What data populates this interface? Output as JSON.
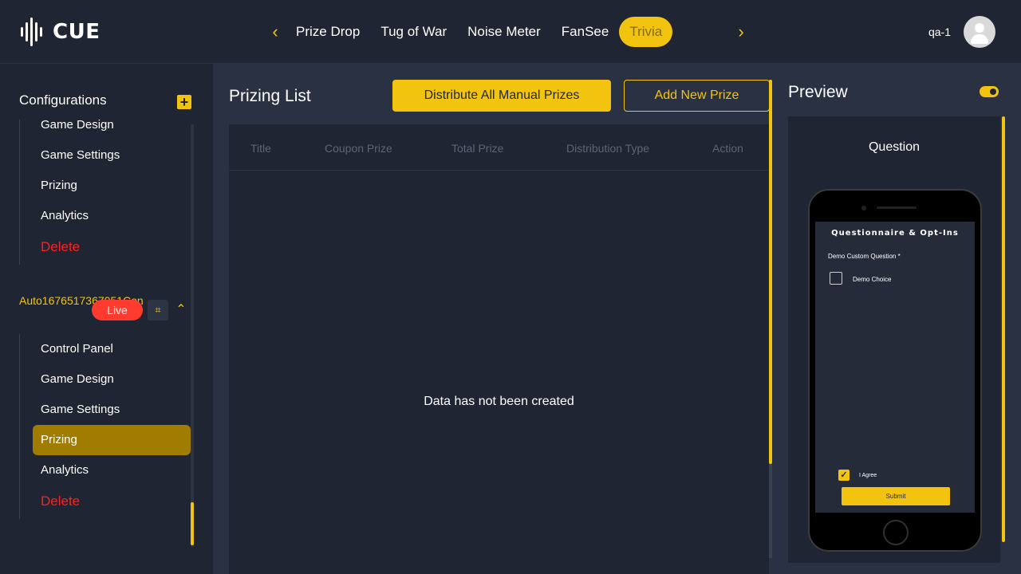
{
  "app": {
    "logo_text": "CUE"
  },
  "header": {
    "tabs": [
      {
        "label": "Prize Drop",
        "active": false
      },
      {
        "label": "Tug of War",
        "active": false
      },
      {
        "label": "Noise Meter",
        "active": false
      },
      {
        "label": "FanSee",
        "active": false
      },
      {
        "label": "Trivia",
        "active": true
      }
    ],
    "username": "qa-1"
  },
  "sidebar": {
    "title": "Configurations",
    "add_icon": "+",
    "prev_group": {
      "items": [
        "Game Design",
        "Game Settings",
        "Prizing",
        "Analytics",
        "Delete"
      ]
    },
    "game": {
      "name": "Auto1676517367051Con",
      "status": "Live",
      "qr_icon": "⌗",
      "collapse_icon": "⌃",
      "items": [
        "Control Panel",
        "Game Design",
        "Game Settings",
        "Prizing",
        "Analytics",
        "Delete"
      ],
      "active_item": "Prizing"
    }
  },
  "main": {
    "title": "Prizing List",
    "distribute_label": "Distribute All Manual Prizes",
    "add_label": "Add New Prize",
    "columns": [
      "Title",
      "Coupon Prize",
      "Total Prize",
      "Distribution Type",
      "Action"
    ],
    "empty_text": "Data has not been created"
  },
  "preview": {
    "title": "Preview",
    "question_label": "Question",
    "screen": {
      "title": "Questionnaire & Opt-Ins",
      "question": "Demo Custom Question *",
      "choice": "Demo Choice",
      "agree_label": "I Agree",
      "submit_label": "Submit"
    }
  },
  "colors": {
    "accent": "#f2c40f",
    "danger": "#ff2020",
    "live": "#ff3b30",
    "bg": "#1f2532",
    "panel": "#2a3142"
  }
}
